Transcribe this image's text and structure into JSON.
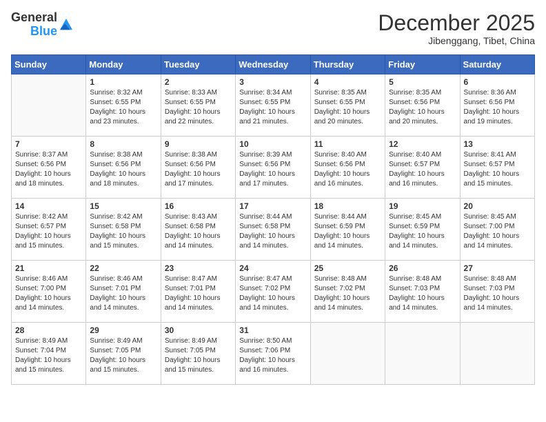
{
  "header": {
    "logo_general": "General",
    "logo_blue": "Blue",
    "month": "December 2025",
    "location": "Jibenggang, Tibet, China"
  },
  "weekdays": [
    "Sunday",
    "Monday",
    "Tuesday",
    "Wednesday",
    "Thursday",
    "Friday",
    "Saturday"
  ],
  "weeks": [
    [
      {
        "day": "",
        "sunrise": "",
        "sunset": "",
        "daylight": ""
      },
      {
        "day": "1",
        "sunrise": "Sunrise: 8:32 AM",
        "sunset": "Sunset: 6:55 PM",
        "daylight": "Daylight: 10 hours and 23 minutes."
      },
      {
        "day": "2",
        "sunrise": "Sunrise: 8:33 AM",
        "sunset": "Sunset: 6:55 PM",
        "daylight": "Daylight: 10 hours and 22 minutes."
      },
      {
        "day": "3",
        "sunrise": "Sunrise: 8:34 AM",
        "sunset": "Sunset: 6:55 PM",
        "daylight": "Daylight: 10 hours and 21 minutes."
      },
      {
        "day": "4",
        "sunrise": "Sunrise: 8:35 AM",
        "sunset": "Sunset: 6:55 PM",
        "daylight": "Daylight: 10 hours and 20 minutes."
      },
      {
        "day": "5",
        "sunrise": "Sunrise: 8:35 AM",
        "sunset": "Sunset: 6:56 PM",
        "daylight": "Daylight: 10 hours and 20 minutes."
      },
      {
        "day": "6",
        "sunrise": "Sunrise: 8:36 AM",
        "sunset": "Sunset: 6:56 PM",
        "daylight": "Daylight: 10 hours and 19 minutes."
      }
    ],
    [
      {
        "day": "7",
        "sunrise": "Sunrise: 8:37 AM",
        "sunset": "Sunset: 6:56 PM",
        "daylight": "Daylight: 10 hours and 18 minutes."
      },
      {
        "day": "8",
        "sunrise": "Sunrise: 8:38 AM",
        "sunset": "Sunset: 6:56 PM",
        "daylight": "Daylight: 10 hours and 18 minutes."
      },
      {
        "day": "9",
        "sunrise": "Sunrise: 8:38 AM",
        "sunset": "Sunset: 6:56 PM",
        "daylight": "Daylight: 10 hours and 17 minutes."
      },
      {
        "day": "10",
        "sunrise": "Sunrise: 8:39 AM",
        "sunset": "Sunset: 6:56 PM",
        "daylight": "Daylight: 10 hours and 17 minutes."
      },
      {
        "day": "11",
        "sunrise": "Sunrise: 8:40 AM",
        "sunset": "Sunset: 6:56 PM",
        "daylight": "Daylight: 10 hours and 16 minutes."
      },
      {
        "day": "12",
        "sunrise": "Sunrise: 8:40 AM",
        "sunset": "Sunset: 6:57 PM",
        "daylight": "Daylight: 10 hours and 16 minutes."
      },
      {
        "day": "13",
        "sunrise": "Sunrise: 8:41 AM",
        "sunset": "Sunset: 6:57 PM",
        "daylight": "Daylight: 10 hours and 15 minutes."
      }
    ],
    [
      {
        "day": "14",
        "sunrise": "Sunrise: 8:42 AM",
        "sunset": "Sunset: 6:57 PM",
        "daylight": "Daylight: 10 hours and 15 minutes."
      },
      {
        "day": "15",
        "sunrise": "Sunrise: 8:42 AM",
        "sunset": "Sunset: 6:58 PM",
        "daylight": "Daylight: 10 hours and 15 minutes."
      },
      {
        "day": "16",
        "sunrise": "Sunrise: 8:43 AM",
        "sunset": "Sunset: 6:58 PM",
        "daylight": "Daylight: 10 hours and 14 minutes."
      },
      {
        "day": "17",
        "sunrise": "Sunrise: 8:44 AM",
        "sunset": "Sunset: 6:58 PM",
        "daylight": "Daylight: 10 hours and 14 minutes."
      },
      {
        "day": "18",
        "sunrise": "Sunrise: 8:44 AM",
        "sunset": "Sunset: 6:59 PM",
        "daylight": "Daylight: 10 hours and 14 minutes."
      },
      {
        "day": "19",
        "sunrise": "Sunrise: 8:45 AM",
        "sunset": "Sunset: 6:59 PM",
        "daylight": "Daylight: 10 hours and 14 minutes."
      },
      {
        "day": "20",
        "sunrise": "Sunrise: 8:45 AM",
        "sunset": "Sunset: 7:00 PM",
        "daylight": "Daylight: 10 hours and 14 minutes."
      }
    ],
    [
      {
        "day": "21",
        "sunrise": "Sunrise: 8:46 AM",
        "sunset": "Sunset: 7:00 PM",
        "daylight": "Daylight: 10 hours and 14 minutes."
      },
      {
        "day": "22",
        "sunrise": "Sunrise: 8:46 AM",
        "sunset": "Sunset: 7:01 PM",
        "daylight": "Daylight: 10 hours and 14 minutes."
      },
      {
        "day": "23",
        "sunrise": "Sunrise: 8:47 AM",
        "sunset": "Sunset: 7:01 PM",
        "daylight": "Daylight: 10 hours and 14 minutes."
      },
      {
        "day": "24",
        "sunrise": "Sunrise: 8:47 AM",
        "sunset": "Sunset: 7:02 PM",
        "daylight": "Daylight: 10 hours and 14 minutes."
      },
      {
        "day": "25",
        "sunrise": "Sunrise: 8:48 AM",
        "sunset": "Sunset: 7:02 PM",
        "daylight": "Daylight: 10 hours and 14 minutes."
      },
      {
        "day": "26",
        "sunrise": "Sunrise: 8:48 AM",
        "sunset": "Sunset: 7:03 PM",
        "daylight": "Daylight: 10 hours and 14 minutes."
      },
      {
        "day": "27",
        "sunrise": "Sunrise: 8:48 AM",
        "sunset": "Sunset: 7:03 PM",
        "daylight": "Daylight: 10 hours and 14 minutes."
      }
    ],
    [
      {
        "day": "28",
        "sunrise": "Sunrise: 8:49 AM",
        "sunset": "Sunset: 7:04 PM",
        "daylight": "Daylight: 10 hours and 15 minutes."
      },
      {
        "day": "29",
        "sunrise": "Sunrise: 8:49 AM",
        "sunset": "Sunset: 7:05 PM",
        "daylight": "Daylight: 10 hours and 15 minutes."
      },
      {
        "day": "30",
        "sunrise": "Sunrise: 8:49 AM",
        "sunset": "Sunset: 7:05 PM",
        "daylight": "Daylight: 10 hours and 15 minutes."
      },
      {
        "day": "31",
        "sunrise": "Sunrise: 8:50 AM",
        "sunset": "Sunset: 7:06 PM",
        "daylight": "Daylight: 10 hours and 16 minutes."
      },
      {
        "day": "",
        "sunrise": "",
        "sunset": "",
        "daylight": ""
      },
      {
        "day": "",
        "sunrise": "",
        "sunset": "",
        "daylight": ""
      },
      {
        "day": "",
        "sunrise": "",
        "sunset": "",
        "daylight": ""
      }
    ]
  ]
}
